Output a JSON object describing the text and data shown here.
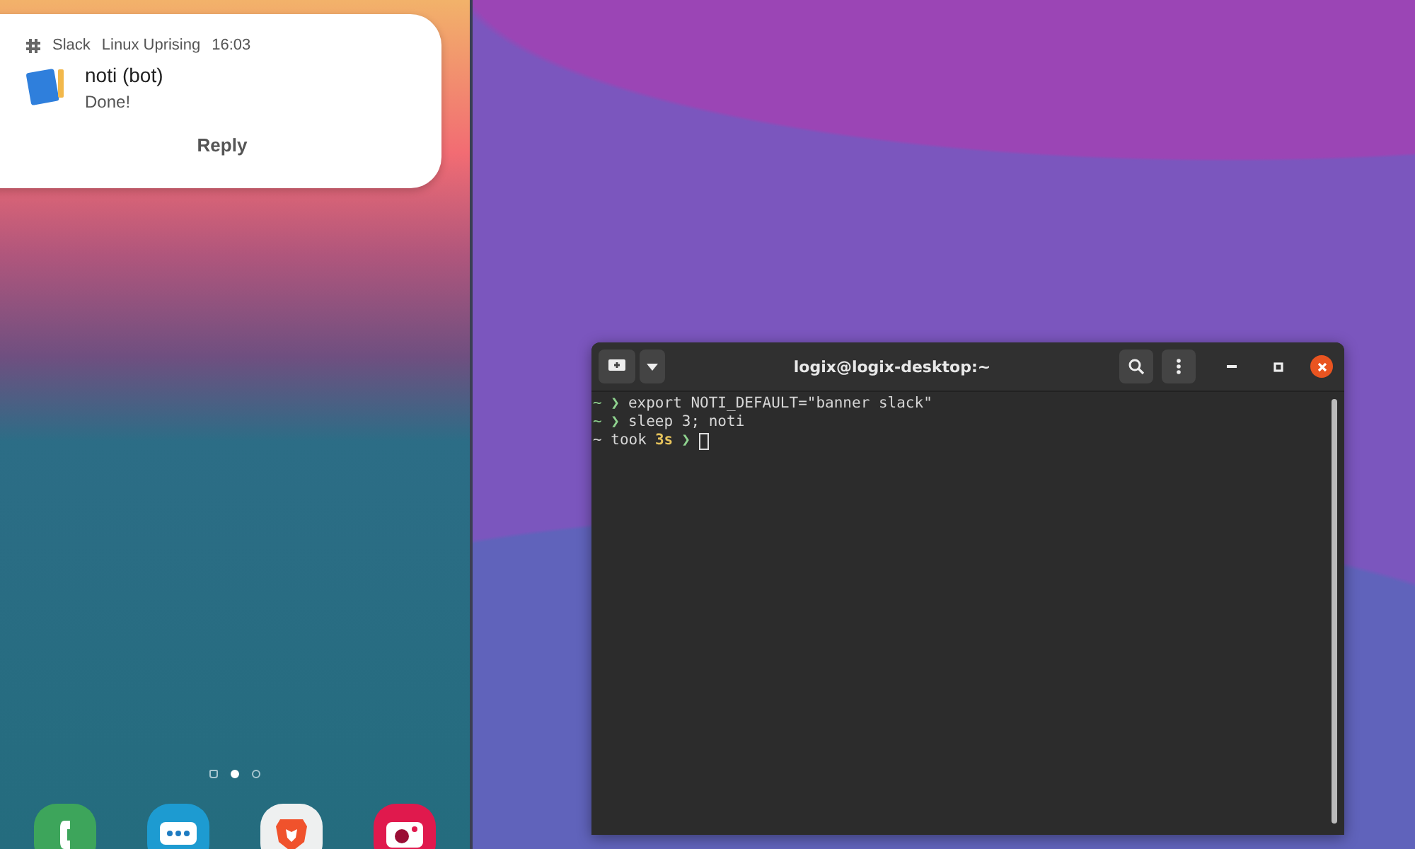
{
  "notification": {
    "app": "Slack",
    "workspace": "Linux Uprising",
    "time": "16:03",
    "sender": "noti (bot)",
    "message": "Done!",
    "action": "Reply"
  },
  "home_pages": [
    {
      "kind": "home",
      "selected": false
    },
    {
      "kind": "page",
      "selected": true
    },
    {
      "kind": "page",
      "selected": false
    }
  ],
  "dock": [
    {
      "kind": "phone"
    },
    {
      "kind": "messages"
    },
    {
      "kind": "lion"
    },
    {
      "kind": "camera"
    }
  ],
  "terminal": {
    "title": "logix@logix-desktop:~",
    "lines": [
      [
        {
          "kind": "prompt",
          "text": "~ ❯"
        },
        {
          "kind": "command",
          "text": "export NOTI_DEFAULT=\"banner slack\""
        }
      ],
      [
        {
          "kind": "prompt",
          "text": "~ ❯"
        },
        {
          "kind": "command",
          "text": "sleep 3; noti"
        }
      ],
      [
        {
          "kind": "command",
          "text": "~ took"
        },
        {
          "kind": "duration",
          "text": "3s"
        },
        {
          "kind": "prompt",
          "text": "❯"
        },
        {
          "kind": "cursor"
        }
      ]
    ]
  }
}
